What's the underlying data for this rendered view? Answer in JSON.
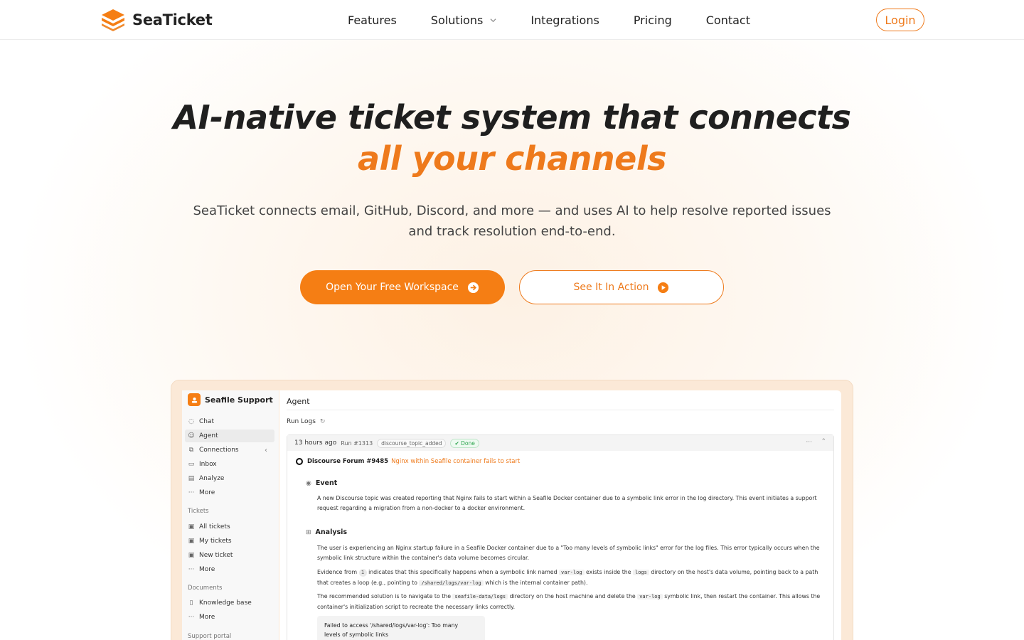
{
  "nav": {
    "brand": "SeaTicket",
    "links": [
      {
        "label": "Features"
      },
      {
        "label": "Solutions"
      },
      {
        "label": "Integrations"
      },
      {
        "label": "Pricing"
      },
      {
        "label": "Contact"
      }
    ],
    "login": "Login"
  },
  "hero": {
    "title_line1": "AI-native ticket system that connects",
    "title_line2": "all your channels",
    "subtitle": "SeaTicket connects email, GitHub, Discord, and more — and uses AI to help resolve reported issues and track resolution end-to-end.",
    "primary_cta": "Open Your Free Workspace",
    "secondary_cta": "See It In Action"
  },
  "colors": {
    "accent": "#f57e14",
    "text": "#1f1f1f",
    "done_green": "#2da44e"
  },
  "preview": {
    "workspace_name": "Seafile Support",
    "sidebar": {
      "main_items": [
        {
          "label": "Chat",
          "icon": "chat-icon"
        },
        {
          "label": "Agent",
          "icon": "agent-icon"
        },
        {
          "label": "Connections",
          "icon": "connections-icon"
        },
        {
          "label": "Inbox",
          "icon": "inbox-icon"
        },
        {
          "label": "Analyze",
          "icon": "analyze-icon"
        },
        {
          "label": "More",
          "icon": "more-icon"
        }
      ],
      "tickets_heading": "Tickets",
      "ticket_items": [
        {
          "label": "All tickets",
          "icon": "tickets-icon"
        },
        {
          "label": "My tickets",
          "icon": "my-tickets-icon"
        },
        {
          "label": "New ticket",
          "icon": "new-ticket-icon"
        },
        {
          "label": "More",
          "icon": "more-icon"
        }
      ],
      "documents_heading": "Documents",
      "document_items": [
        {
          "label": "Knowledge base",
          "icon": "book-icon"
        },
        {
          "label": "More",
          "icon": "more-icon"
        }
      ],
      "portal_heading": "Support portal"
    },
    "main": {
      "title": "Agent",
      "run_logs": "Run Logs",
      "run": {
        "time": "13 hours ago",
        "run_id": "Run #1313",
        "tag": "discourse_topic_added",
        "status": "Done",
        "forum_title": "Discourse Forum #9485",
        "forum_link": "Nginx within Seafile container fails to start"
      },
      "event": {
        "heading": "Event",
        "text": "A new Discourse topic was created reporting that Nginx fails to start within a Seafile Docker container due to a symbolic link error in the log directory. This event initiates a support request regarding a migration from a non-docker to a docker environment."
      },
      "analysis": {
        "heading": "Analysis",
        "para1": "The user is experiencing an Nginx startup failure in a Seafile Docker container due to a \"Too many levels of symbolic links\" error for the log files. This error typically occurs when the symbolic link structure within the container's data volume becomes circular.",
        "para2_a": "Evidence from",
        "para2_cite": "1",
        "para2_b": "indicates that this specifically happens when a symbolic link named",
        "para2_code1": "var-log",
        "para2_c": "exists inside the",
        "para2_code2": "logs",
        "para2_d": "directory on the host's data volume, pointing back to a path that creates a loop (e.g., pointing to",
        "para2_code3": "/shared/logs/var-log",
        "para2_e": "which is the internal container path).",
        "para3_a": "The recommended solution is to navigate to the",
        "para3_code1": "seafile-data/logs",
        "para3_b": "directory on the host machine and delete the",
        "para3_code2": "var-log",
        "para3_c": "symbolic link, then restart the container. This allows the container's initialization script to recreate the necessary links correctly.",
        "error_line1": "Failed to access '/shared/logs/var-log': Too many",
        "error_line2": "levels of symbolic links"
      }
    }
  }
}
